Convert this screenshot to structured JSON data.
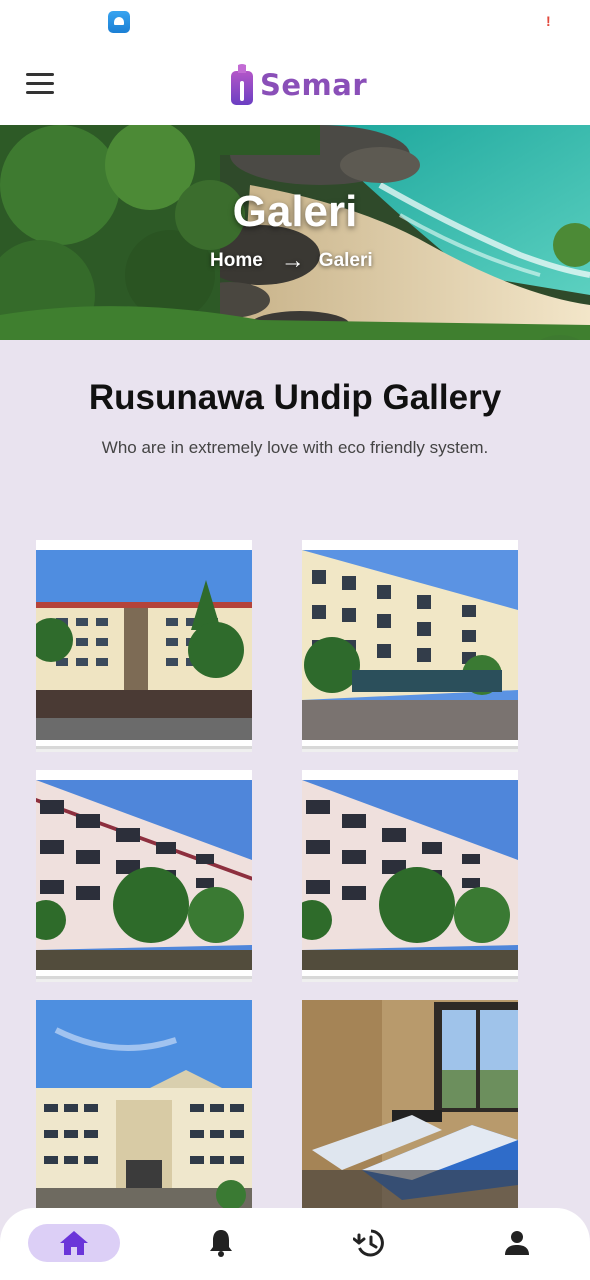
{
  "app": {
    "name": "Semar"
  },
  "colors": {
    "brand": "#8a4fb8",
    "background": "#e9e3ef",
    "active_tab": "#dccff6",
    "active_icon": "#6a35d9"
  },
  "statusbar": {
    "icons": [
      "cloud-app-icon",
      "alert-icon"
    ],
    "alert_glyph": "!"
  },
  "header": {
    "menu_icon": "hamburger-menu-icon"
  },
  "hero": {
    "title": "Galeri",
    "breadcrumb": {
      "home": "Home",
      "separator": "→",
      "current": "Galeri"
    }
  },
  "section": {
    "title": "Rusunawa Undip Gallery",
    "subtitle": "Who are in extremely love with eco friendly system."
  },
  "gallery": [
    {
      "subject": "dormitory-building-with-fence"
    },
    {
      "subject": "dormitory-building-with-trees"
    },
    {
      "subject": "dormitory-building-red-facade"
    },
    {
      "subject": "dormitory-building-red-facade"
    },
    {
      "subject": "dormitory-building-front-entrance"
    },
    {
      "subject": "dorm-room-with-beds"
    }
  ],
  "bottom_nav": [
    {
      "icon": "home-icon",
      "active": true
    },
    {
      "icon": "bell-icon",
      "active": false
    },
    {
      "icon": "history-icon",
      "active": false
    },
    {
      "icon": "profile-icon",
      "active": false
    }
  ]
}
